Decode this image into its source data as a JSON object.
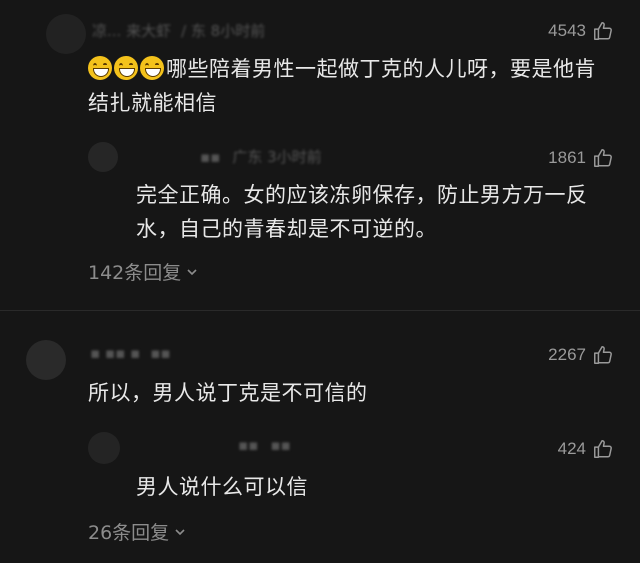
{
  "comments": [
    {
      "username": "凉... 来大虾",
      "meta": "/ 东 8小时前",
      "likes": "4543",
      "text": "哪些陪着男性一起做丁克的人儿呀，要是他肯结扎就能相信",
      "emoji_count": 3,
      "reply": {
        "username": "▪▪",
        "meta": "广东 3小时前",
        "likes": "1861",
        "text": "完全正确。女的应该冻卵保存，防止男方万一反水，自己的青春却是不可逆的。"
      },
      "replies_label": "142条回复"
    },
    {
      "username": "▪ ▪▪ ▪",
      "meta": "▪▪",
      "likes": "2267",
      "text": "所以，男人说丁克是不可信的",
      "reply": {
        "username": "▪▪",
        "meta": "▪▪",
        "likes": "424",
        "text": "男人说什么可以信"
      },
      "replies_label": "26条回复"
    }
  ],
  "icons": {
    "like": "thumbs-up-icon",
    "expand": "chevron-down-icon"
  },
  "colors": {
    "background": "#161616",
    "text": "#e8e8e8",
    "muted": "#8c8c8c"
  }
}
